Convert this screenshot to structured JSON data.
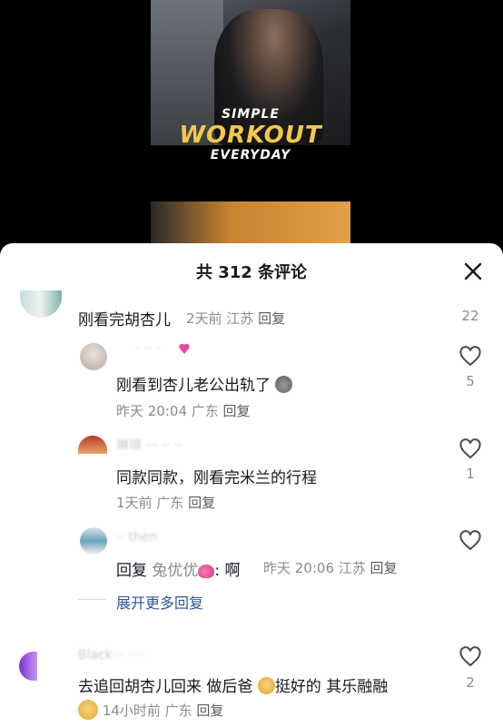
{
  "video": {
    "overlay_line1": "SIMPLE",
    "overlay_line2": "WORKOUT",
    "overlay_line3": "EVERYDAY"
  },
  "sheet": {
    "title": "共 312 条评论",
    "close_icon": "close-icon"
  },
  "comments": [
    {
      "text": "刚看完胡杏儿",
      "meta": "2天前 江苏",
      "reply": "回复",
      "likes": "22"
    },
    {
      "username_faded": "· ·· ·",
      "text": "刚看到杏儿老公出轨了",
      "emoji": "money-bag-emoji",
      "meta": "昨天 20:04 广东",
      "reply": "回复",
      "likes": "5"
    },
    {
      "username_faded": "琳琅 ··· ·· ··",
      "text": "同款同款，刚看完米兰的行程",
      "meta": "1天前 广东",
      "reply": "回复",
      "likes": "1"
    },
    {
      "username_faded": "·· then",
      "reply_prefix": "回复",
      "reply_to": "兔优优",
      "emoji": "two-hearts-emoji",
      "text": ": 啊",
      "meta": "昨天 20:06 江苏",
      "reply": "回复"
    },
    {
      "username_faded": "Black··· ····",
      "text_part1": "去追回胡杏儿回来 做后爸",
      "text_part2": "挺好的 其乐融融",
      "emoji": "doge-emoji",
      "meta": "14小时前 广东",
      "reply": "回复",
      "likes": "2"
    }
  ],
  "expand_replies": "展开更多回复",
  "colors": {
    "link": "#2f5597",
    "meta": "#8a8b91",
    "text": "#161823",
    "overlay_yellow": "#f4c84a"
  }
}
